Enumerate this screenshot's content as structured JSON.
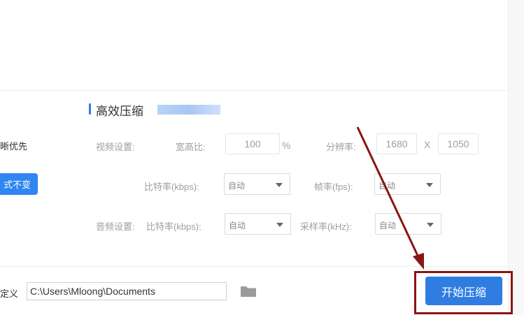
{
  "section": {
    "title": "高效压缩"
  },
  "left": {
    "quality_priority": "晰优先",
    "keep_format_button": "式不变"
  },
  "video": {
    "label": "视频设置:",
    "aspect_label": "宽高比:",
    "aspect_value": "100",
    "aspect_unit": "%",
    "resolution_label": "分辨率:",
    "res_width": "1680",
    "res_sep": "X",
    "res_height": "1050",
    "bitrate_label": "比特率(kbps):",
    "bitrate_value": "自动",
    "framerate_label": "帧率(fps):",
    "framerate_value": "自动"
  },
  "audio": {
    "label": "音频设置:",
    "bitrate_label": "比特率(kbps):",
    "bitrate_value": "自动",
    "samplerate_label": "采样率(kHz):",
    "samplerate_value": "自动"
  },
  "output": {
    "custom_label": "定义",
    "path": "C:\\Users\\Mloong\\Documents",
    "start_button": "开始压缩"
  },
  "colors": {
    "accent": "#2f7de1",
    "annotation": "#8a1414"
  }
}
